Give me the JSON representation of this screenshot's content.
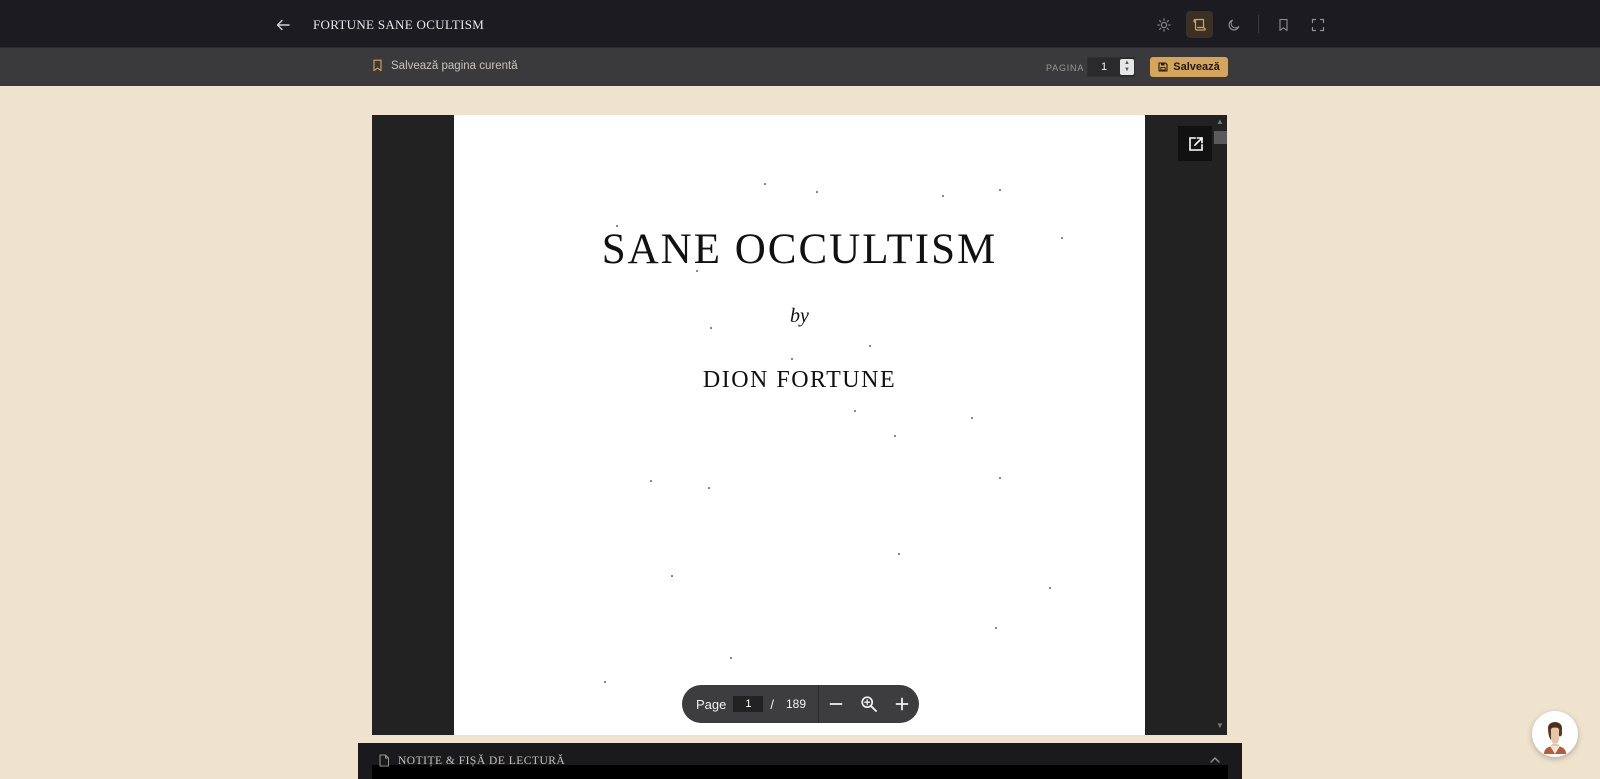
{
  "header": {
    "title": "FORTUNE SANE OCULTISM",
    "icons": [
      "arrow-left-icon",
      "sun-icon",
      "scroll-icon",
      "moon-icon",
      "bookmark-icon",
      "fullscreen-icon"
    ],
    "active_theme": "sepia",
    "accent_color": "#d4a55a"
  },
  "savebar": {
    "save_current_label": "Salvează pagina curentă",
    "page_label": "PAGINA",
    "page_value": "1",
    "save_button_label": "Salvează"
  },
  "pdf": {
    "title": "SANE OCCULTISM",
    "by": "by",
    "author": "DION FORTUNE"
  },
  "pdf_toolbar": {
    "page_label": "Page",
    "current_page": "1",
    "separator": "/",
    "total_pages": "189"
  },
  "notes": {
    "title": "NOTIȚE & FIȘĂ DE LECTURĂ"
  }
}
